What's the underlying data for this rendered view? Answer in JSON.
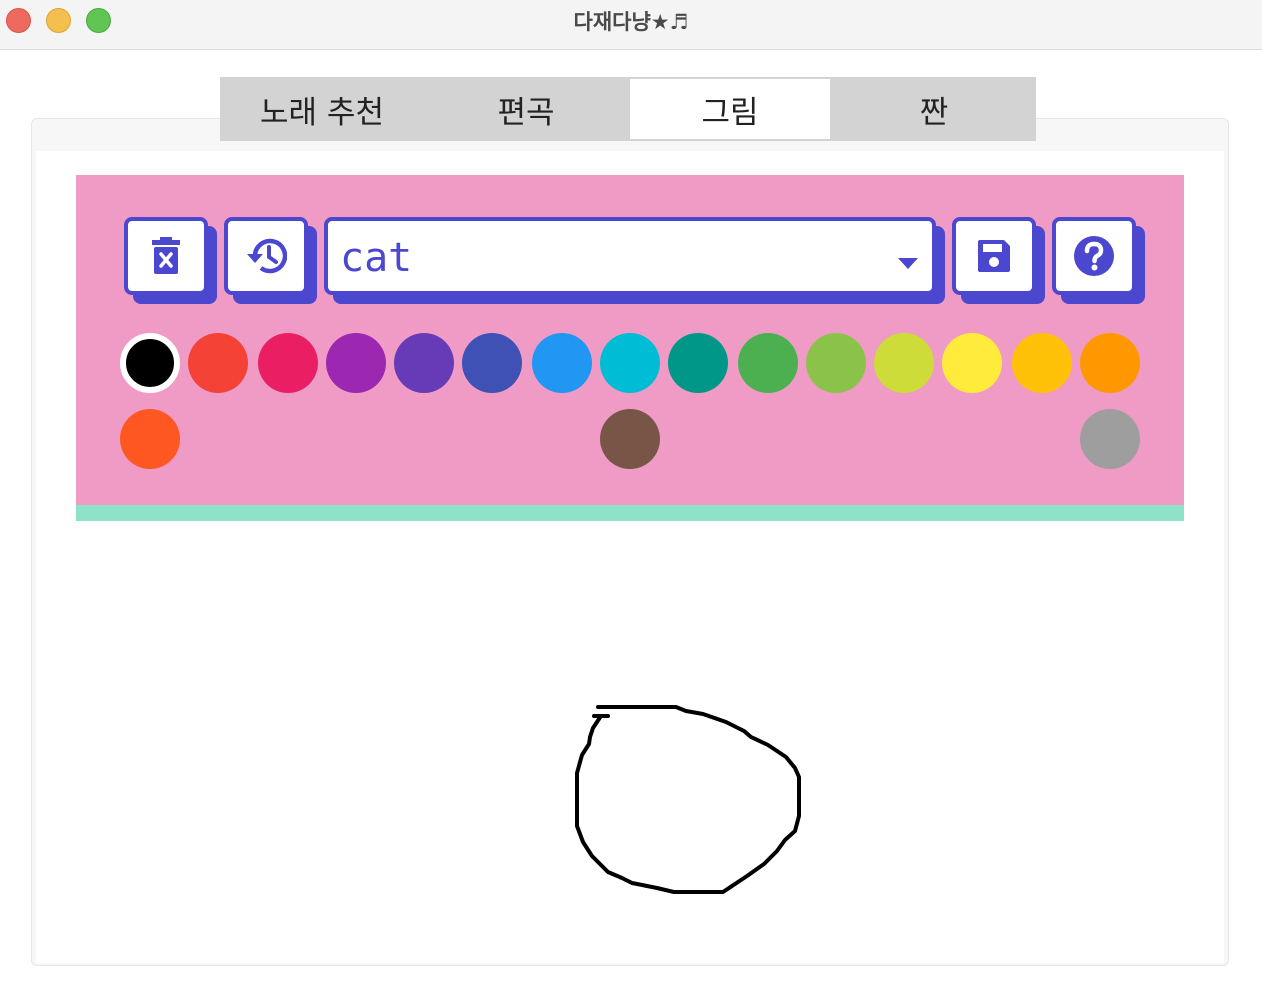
{
  "window": {
    "title": "다재다냥★♬"
  },
  "tabs": [
    {
      "label": "노래 추천",
      "active": false
    },
    {
      "label": "편곡",
      "active": false
    },
    {
      "label": "그림",
      "active": true
    },
    {
      "label": "짠",
      "active": false
    }
  ],
  "toolbar": {
    "delete_icon": "trash-x-icon",
    "history_icon": "history-icon",
    "save_icon": "floppy-disk-icon",
    "help_icon": "question-circle-icon",
    "select_value": "cat",
    "accent_color": "#4b47cf"
  },
  "palette": {
    "selected_index": 0,
    "colors": [
      "#000000",
      "#f44336",
      "#e91e63",
      "#9c27b0",
      "#673ab7",
      "#3f51b5",
      "#2196f3",
      "#00bcd4",
      "#009688",
      "#4caf50",
      "#8bc34a",
      "#cddc39",
      "#ffeb3b",
      "#ffc107",
      "#ff9800",
      "#ff5722",
      "#795548",
      "#9e9e9e"
    ]
  },
  "colors": {
    "toolbar_bg": "#f09ac6",
    "strip": "#8ee2c8"
  }
}
